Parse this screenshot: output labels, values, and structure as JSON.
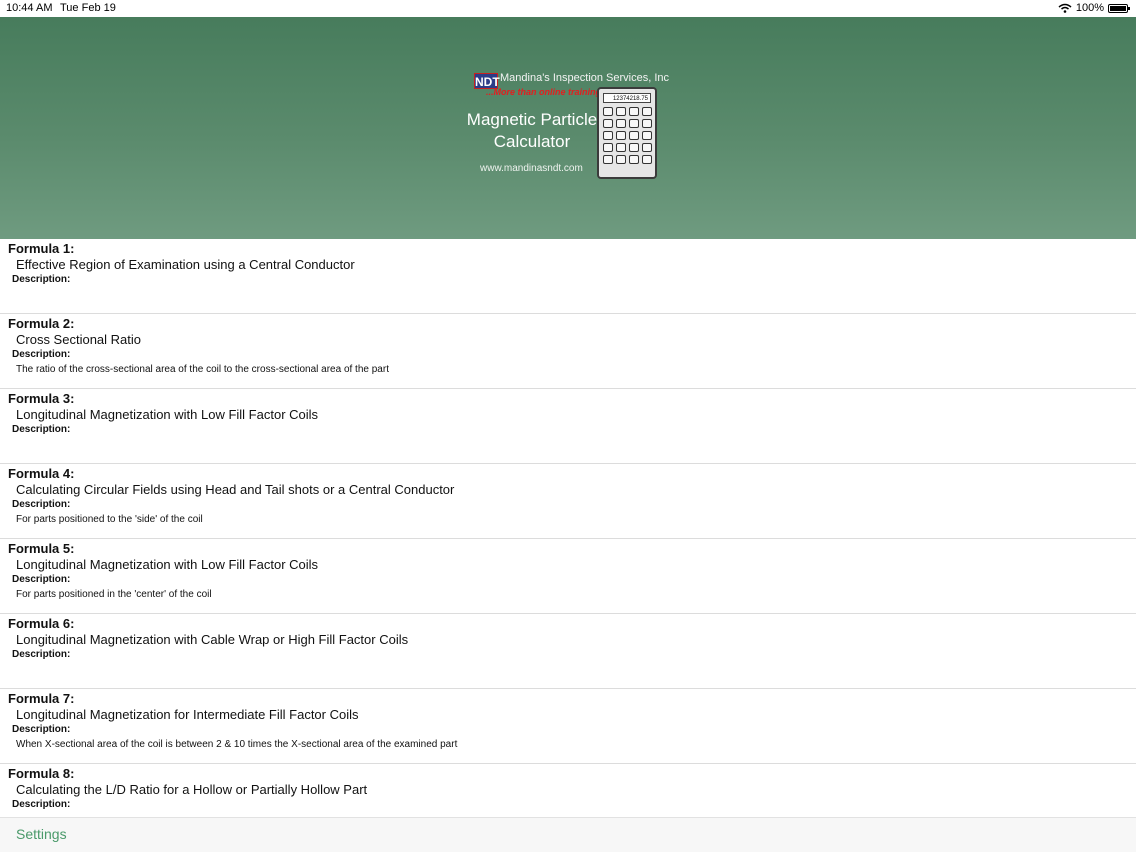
{
  "status": {
    "time": "10:44 AM",
    "date": "Tue Feb 19",
    "battery": "100%"
  },
  "header": {
    "logo_text": "NDT",
    "company": "Mandina's Inspection Services, Inc",
    "tagline": "...More than online training",
    "title_line1": "Magnetic Particle",
    "title_line2": "Calculator",
    "website": "www.mandinasndt.com",
    "calc_display": "12374218.75"
  },
  "formulas": [
    {
      "label": "Formula 1:",
      "title": "Effective Region of Examination using a Central Conductor",
      "desc_label": "Description:",
      "desc": ""
    },
    {
      "label": "Formula 2:",
      "title": "Cross Sectional Ratio",
      "desc_label": "Description:",
      "desc": "The ratio of the cross-sectional area of the coil to the cross-sectional area of the part"
    },
    {
      "label": "Formula 3:",
      "title": "Longitudinal Magnetization with Low Fill Factor Coils",
      "desc_label": "Description:",
      "desc": ""
    },
    {
      "label": "Formula 4:",
      "title": "Calculating Circular Fields using Head and Tail shots or a Central Conductor",
      "desc_label": "Description:",
      "desc": "For parts positioned to the 'side' of the coil"
    },
    {
      "label": "Formula 5:",
      "title": "Longitudinal Magnetization with Low Fill Factor Coils",
      "desc_label": "Description:",
      "desc": "For parts positioned in the 'center' of the coil"
    },
    {
      "label": "Formula 6:",
      "title": "Longitudinal Magnetization with Cable Wrap or High Fill Factor Coils",
      "desc_label": "Description:",
      "desc": ""
    },
    {
      "label": "Formula 7:",
      "title": "Longitudinal Magnetization for Intermediate Fill Factor Coils",
      "desc_label": "Description:",
      "desc": "When X-sectional area of the coil is between 2 & 10 times the X-sectional area of the examined part"
    },
    {
      "label": "Formula 8:",
      "title": "Calculating the L/D Ratio for a Hollow or Partially Hollow Part",
      "desc_label": "Description:",
      "desc": ""
    }
  ],
  "bottom": {
    "settings_label": "Settings"
  }
}
